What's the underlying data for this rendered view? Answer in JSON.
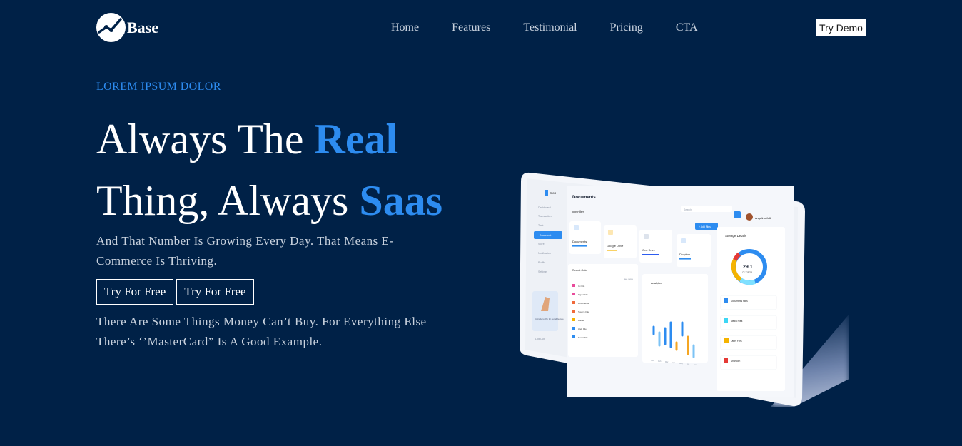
{
  "header": {
    "logo_text": "Base",
    "nav": [
      "Home",
      "Features",
      "Testimonial",
      "Pricing",
      "CTA"
    ],
    "cta_label": "Try Demo"
  },
  "hero": {
    "eyebrow": "LOREM IPSUM DOLOR",
    "line1_plain": "Always The ",
    "line1_accent": "Real",
    "line2_plain": "Thing, Always ",
    "line2_accent": "Saas",
    "subtitle": "And That Number Is Growing Every Day. That Means E-Commerce Is Thriving.",
    "button1": "Try For Free",
    "button2": "Try For Free",
    "paragraph": "There Are Some Things Money Can’t Buy. For Everything Else There’s ‘’MasterCard” Is A Good Example."
  },
  "mockup": {
    "page_title": "Documents",
    "brand": "Stop",
    "search_placeholder": "Search",
    "user_name": "Angelina Jolli",
    "my_files_label": "My Files",
    "add_files": "+ Add Files",
    "folders": [
      "Documents",
      "Google Drive",
      "One Drive",
      "Dropbox"
    ],
    "sidebar": [
      "Dashboard",
      "Transaction",
      "Task",
      "Document",
      "Store",
      "Notification",
      "Profile",
      "Settings"
    ],
    "recent_order": "Recent Order",
    "see_more": "See more",
    "files": [
      "Cv File",
      "Figma File",
      "Documents",
      "Source File",
      "Folder",
      "Web File",
      "Sonar File"
    ],
    "analytics": "Analytics",
    "months": [
      "Jan",
      "Feb",
      "Mar",
      "Apr",
      "May",
      "Jun",
      "Jul"
    ],
    "storage_title": "Storage Details",
    "storage_value": "29.1",
    "storage_of": "Of 128GB",
    "storage_items": [
      "Documents Files",
      "Media Files",
      "Other Files",
      "Unknown"
    ],
    "logout": "Log Out",
    "upgrade": "Upgrade to Pro for get all feature"
  },
  "colors": {
    "background": "#002147",
    "accent": "#2d8cf0",
    "text_muted": "#c9d2de"
  }
}
